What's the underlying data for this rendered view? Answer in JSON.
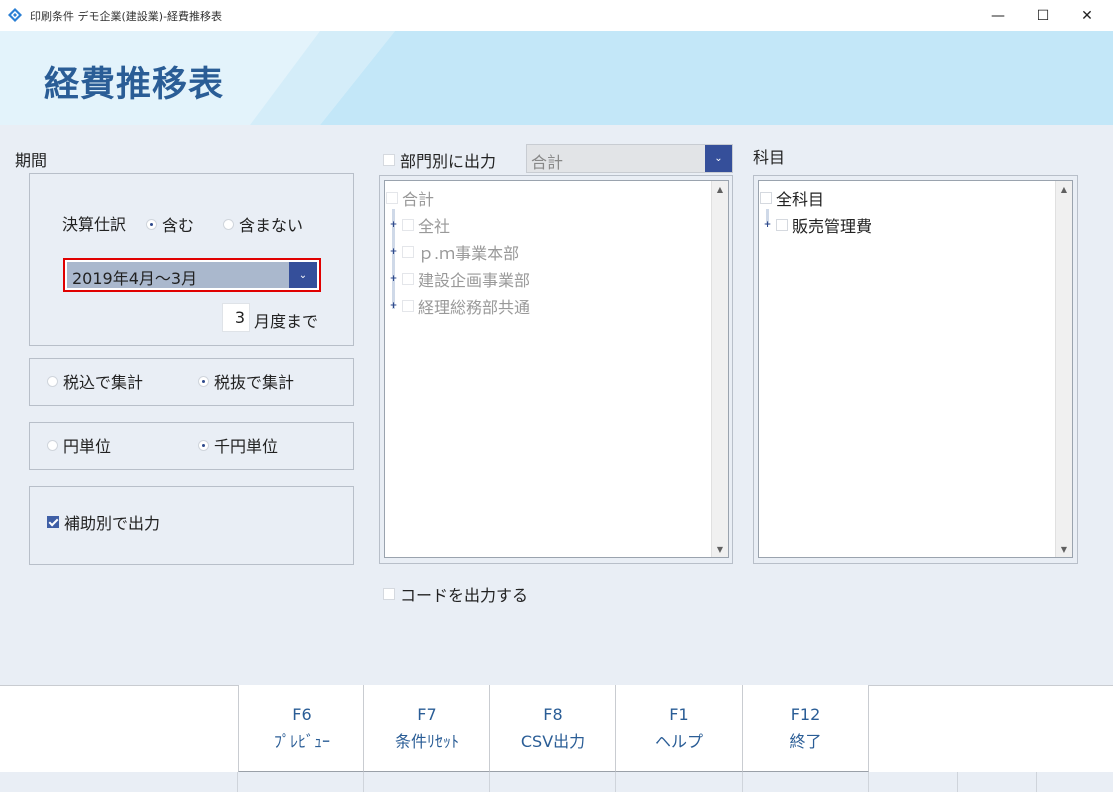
{
  "window": {
    "title": "印刷条件 デモ企業(建設業)-経費推移表",
    "minimize": "—",
    "maximize": "☐",
    "close": "✕"
  },
  "header": {
    "page_title": "経費推移表"
  },
  "period": {
    "label": "期間",
    "settlement_label": "決算仕訳",
    "include": "含む",
    "exclude": "含まない",
    "include_selected": true,
    "range_value": "2019年4月～3月",
    "month_value": "3",
    "month_suffix": "月度まで"
  },
  "tax": {
    "incl": "税込で集計",
    "excl": "税抜で集計",
    "selected": "excl"
  },
  "unit": {
    "yen": "円単位",
    "thousand": "千円単位",
    "selected": "thousand"
  },
  "aux": {
    "label": "補助別で出力",
    "checked": true
  },
  "department": {
    "checkbox_label": "部門別に出力",
    "checked": false,
    "select_value": "合計",
    "tree_root": "合計",
    "items": [
      "全社",
      "ｐ.ｍ事業本部",
      "建設企画事業部",
      "経理総務部共通"
    ]
  },
  "account": {
    "label": "科目",
    "tree_root": "全科目",
    "items": [
      "販売管理費"
    ]
  },
  "code_output": {
    "label": "コードを出力する",
    "checked": false
  },
  "fkeys": [
    {
      "key": "F6",
      "label": "ﾌﾟﾚﾋﾞｭｰ"
    },
    {
      "key": "F7",
      "label": "条件ﾘｾｯﾄ"
    },
    {
      "key": "F8",
      "label": "CSV出力"
    },
    {
      "key": "F1",
      "label": "ヘルプ"
    },
    {
      "key": "F12",
      "label": "終了"
    }
  ],
  "colors": {
    "accent": "#354f9a",
    "title": "#2a5d96",
    "banner": "#c3e7f8",
    "highlight_border": "#e00000"
  }
}
